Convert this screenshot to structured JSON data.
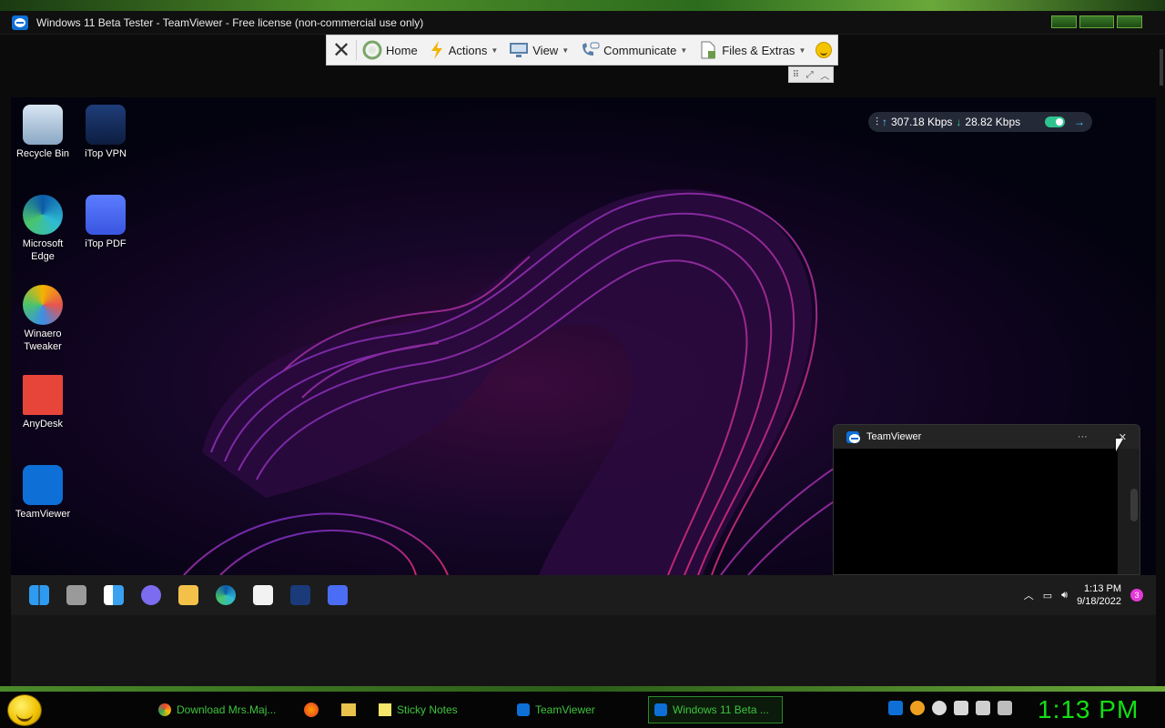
{
  "window": {
    "title": "Windows 11 Beta Tester - TeamViewer - Free license (non-commercial use only)"
  },
  "toolbar": {
    "close_icon": "close-icon",
    "home": "Home",
    "actions": "Actions",
    "view": "View",
    "communicate": "Communicate",
    "files": "Files & Extras"
  },
  "desktop": {
    "icons": [
      {
        "label": "Recycle Bin",
        "icon": "recycle-bin-icon"
      },
      {
        "label": "iTop VPN",
        "icon": "itop-vpn-icon"
      },
      {
        "label": "Microsoft Edge",
        "icon": "edge-icon"
      },
      {
        "label": "iTop PDF",
        "icon": "itop-pdf-icon"
      },
      {
        "label": "Winaero Tweaker",
        "icon": "winaero-icon"
      },
      {
        "label": "AnyDesk",
        "icon": "anydesk-icon"
      },
      {
        "label": "TeamViewer",
        "icon": "teamviewer-icon"
      }
    ]
  },
  "network": {
    "upload": "307.18 Kbps",
    "download": "28.82 Kbps"
  },
  "popup": {
    "title": "TeamViewer",
    "more": "···"
  },
  "remote_taskbar": {
    "time": "1:13 PM",
    "date": "9/18/2022",
    "notifications": "3"
  },
  "host_taskbar": {
    "tasks": [
      "Download Mrs.Maj...",
      "Sticky Notes",
      "TeamViewer",
      "Windows 11 Beta ..."
    ],
    "clock": "1:13 PM"
  },
  "colors": {
    "host_green": "#14e014",
    "accent": "#0e6fd6"
  }
}
